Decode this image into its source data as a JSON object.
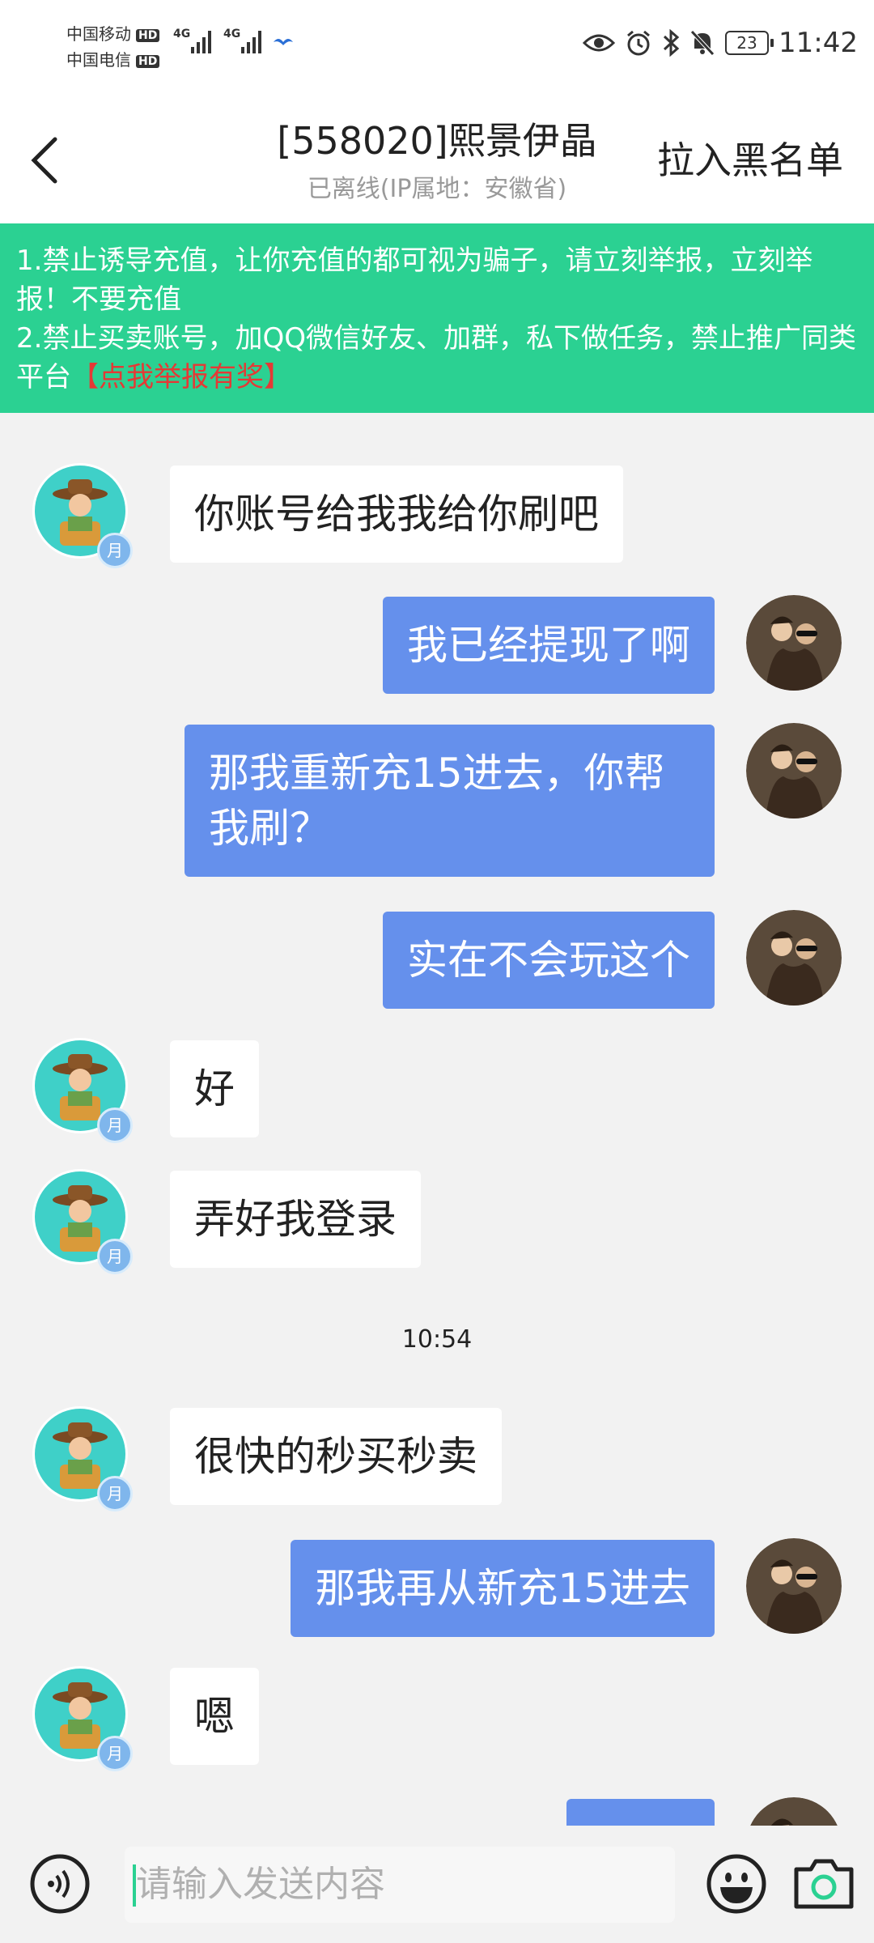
{
  "status_bar": {
    "carrier1": "中国移动",
    "carrier2": "中国电信",
    "hd1": "HD",
    "hd2": "HD",
    "net1": "4G",
    "net2": "4G",
    "battery": "23",
    "time": "11:42"
  },
  "header": {
    "title": "[558020]熙景伊晶",
    "subtitle": "已离线(IP属地：安徽省)",
    "blacklist_label": "拉入黑名单"
  },
  "notice": {
    "line1": "1.禁止诱导充值，让你充值的都可视为骗子，请立刻举报，立刻举报！不要充值",
    "line2": "2.禁止买卖账号，加QQ微信好友、加群，私下做任务，禁止推广同类平台",
    "report_link": "【点我举报有奖】"
  },
  "badge_label": "月",
  "messages": [
    {
      "side": "other",
      "text": "你账号给我我给你刷吧"
    },
    {
      "side": "me",
      "text": "我已经提现了啊"
    },
    {
      "side": "me",
      "text": "那我重新充15进去，你帮我刷？"
    },
    {
      "side": "me",
      "text": "实在不会玩这个"
    },
    {
      "side": "other",
      "text": "好"
    },
    {
      "side": "other",
      "text": "弄好我登录"
    },
    {
      "side": "other",
      "text": "很快的秒买秒卖"
    },
    {
      "side": "me",
      "text": "那我再从新充15进去"
    },
    {
      "side": "other",
      "text": "嗯"
    },
    {
      "side": "me",
      "text": ""
    }
  ],
  "timestamp": "10:54",
  "input": {
    "placeholder": "请输入发送内容"
  },
  "colors": {
    "accent": "#2bd192",
    "my_bubble": "#6590ec",
    "report_red": "#e53935"
  },
  "icons": [
    "back-arrow-icon",
    "voice-icon",
    "emoji-icon",
    "camera-icon",
    "eye-icon",
    "alarm-icon",
    "bluetooth-icon",
    "mute-icon"
  ]
}
